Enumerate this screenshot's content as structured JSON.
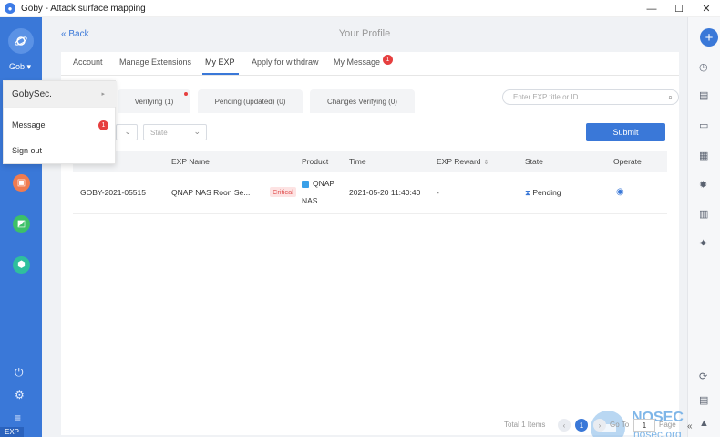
{
  "window": {
    "title": "Goby - Attack surface mapping"
  },
  "user": {
    "name": "Gob",
    "caret": "▾"
  },
  "dropdown": {
    "items": [
      {
        "label": "GobySec."
      },
      {
        "label": "Message",
        "badge": "1"
      },
      {
        "label": "Sign out"
      }
    ]
  },
  "header": {
    "back": "Back",
    "title": "Your Profile"
  },
  "tabs": {
    "items": [
      "Account",
      "Manage Extensions",
      "My EXP",
      "Apply for withdraw",
      "My Message"
    ],
    "message_badge": "1"
  },
  "subtabs": [
    "Verifying (1)",
    "Pending (updated) (0)",
    "Changes Verifying (0)"
  ],
  "search": {
    "placeholder": "Enter EXP title or ID"
  },
  "filters": {
    "state_placeholder": "State"
  },
  "submit_label": "Submit",
  "table": {
    "headers": [
      "EXP Name",
      "Product",
      "Time",
      "EXP Reward",
      "State",
      "Operate"
    ],
    "rows": [
      {
        "id": "GOBY-2021-05515",
        "name": "QNAP NAS Roon Se...",
        "severity": "Critical",
        "product_line1": "QNAP",
        "product_line2": "NAS",
        "time": "2021-05-20 11:40:40",
        "reward": "-",
        "state": "Pending"
      }
    ]
  },
  "pagination": {
    "total": "Total 1 Items",
    "current": "1",
    "goto": "Go To",
    "input_value": "1",
    "page": "Page"
  },
  "watermark": {
    "brand": "NOSEC",
    "domain": "nosec.org"
  },
  "exp_tag": "EXP",
  "colors": {
    "accent": "#3a78d8",
    "danger": "#e63f3f"
  }
}
